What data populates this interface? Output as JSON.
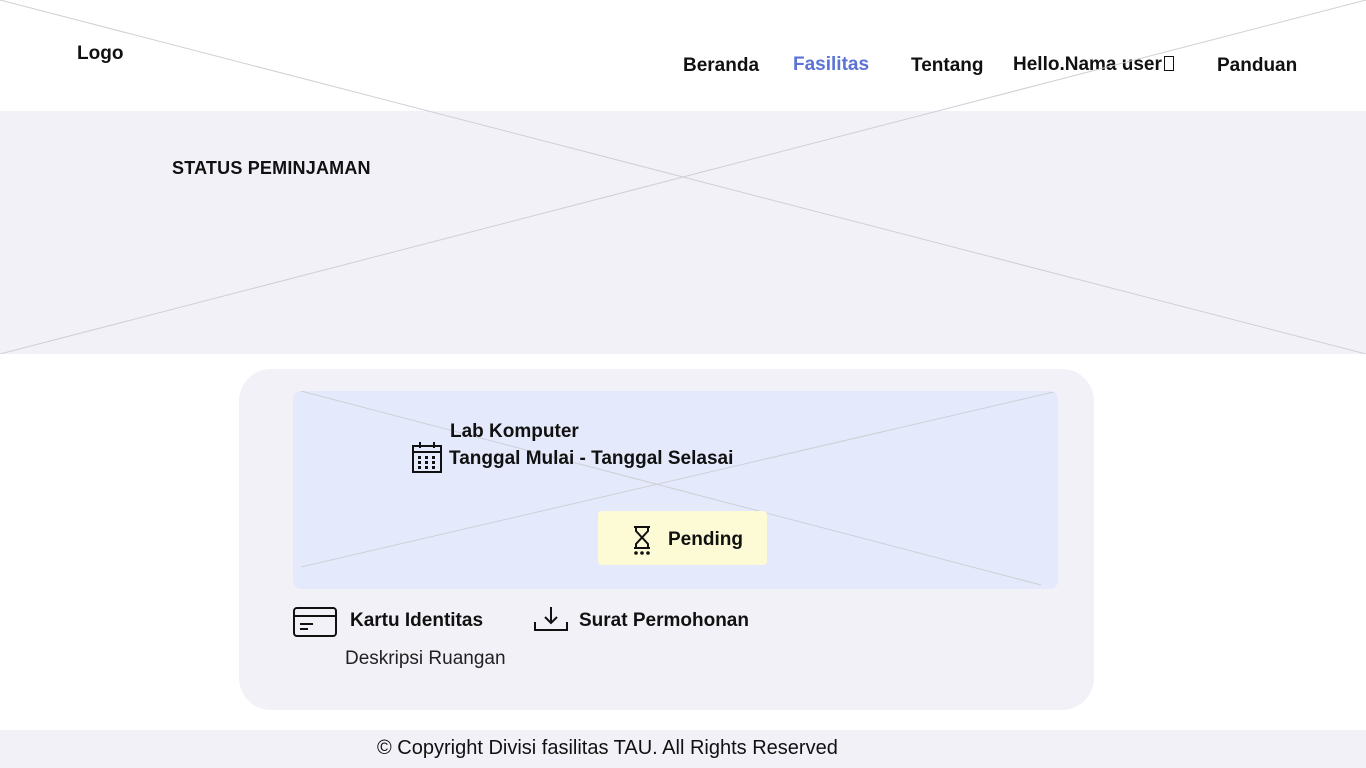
{
  "header": {
    "logo": "Logo",
    "nav": {
      "beranda": "Beranda",
      "fasilitas": "Fasilitas",
      "tentang": "Tentang",
      "user": "Hello.Nama user",
      "panduan": "Panduan"
    },
    "active_color": "#5b73d4"
  },
  "hero": {
    "title": "STATUS PEMINJAMAN"
  },
  "booking": {
    "facility": "Lab Komputer",
    "dates": "Tanggal Mulai - Tanggal Selasai",
    "status": "Pending",
    "status_bg": "#fdfbd6",
    "id_card_label": "Kartu Identitas",
    "letter_label": "Surat Permohonan",
    "description": "Deskripsi Ruangan"
  },
  "footer": {
    "copyright": "© Copyright Divisi fasilitas TAU. All Rights Reserved"
  },
  "icons": [
    "user-icon",
    "calendar-icon",
    "hourglass-icon",
    "id-card-icon",
    "download-icon"
  ]
}
